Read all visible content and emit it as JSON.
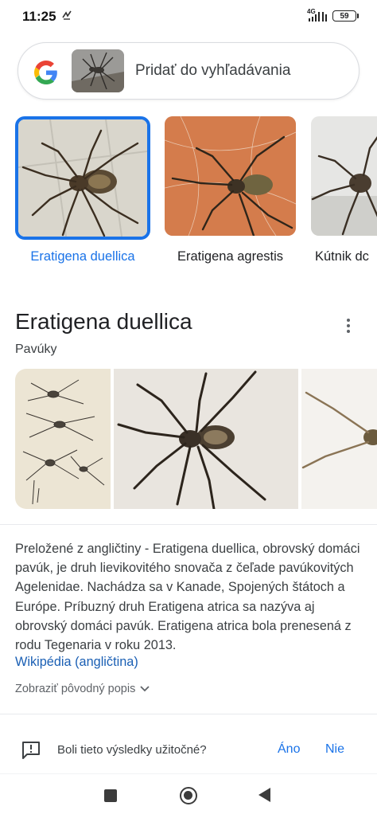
{
  "status_bar": {
    "time": "11:25",
    "network": "4G",
    "battery": "59"
  },
  "search": {
    "placeholder_label": "Pridať do vyhľadávania"
  },
  "visual_results": [
    {
      "label": "Eratigena duellica",
      "selected": true
    },
    {
      "label": "Eratigena agrestis",
      "selected": false
    },
    {
      "label": "Kútnik dc",
      "selected": false
    }
  ],
  "knowledge_panel": {
    "title": "Eratigena duellica",
    "subtitle": "Pavúky",
    "description": "Preložené z angličtiny - Eratigena duellica, obrovský domáci pavúk, je druh lievikovitého snovača z čeľade pavúkovitých Agelenidae. Nachádza sa v Kanade, Spojených štátoch a Európe. Príbuzný druh Eratigena atrica sa nazýva aj obrovský domáci pavúk. Eratigena atrica bola prenesená z rodu Tegenaria v roku 2013.",
    "source_link": "Wikipédia (angličtina)",
    "show_original": "Zobraziť pôvodný popis"
  },
  "feedback": {
    "question": "Boli tieto výsledky užitočné?",
    "yes": "Áno",
    "no": "Nie"
  },
  "colors": {
    "accent": "#1a73e8",
    "text": "#202124",
    "secondary": "#5f6368"
  }
}
